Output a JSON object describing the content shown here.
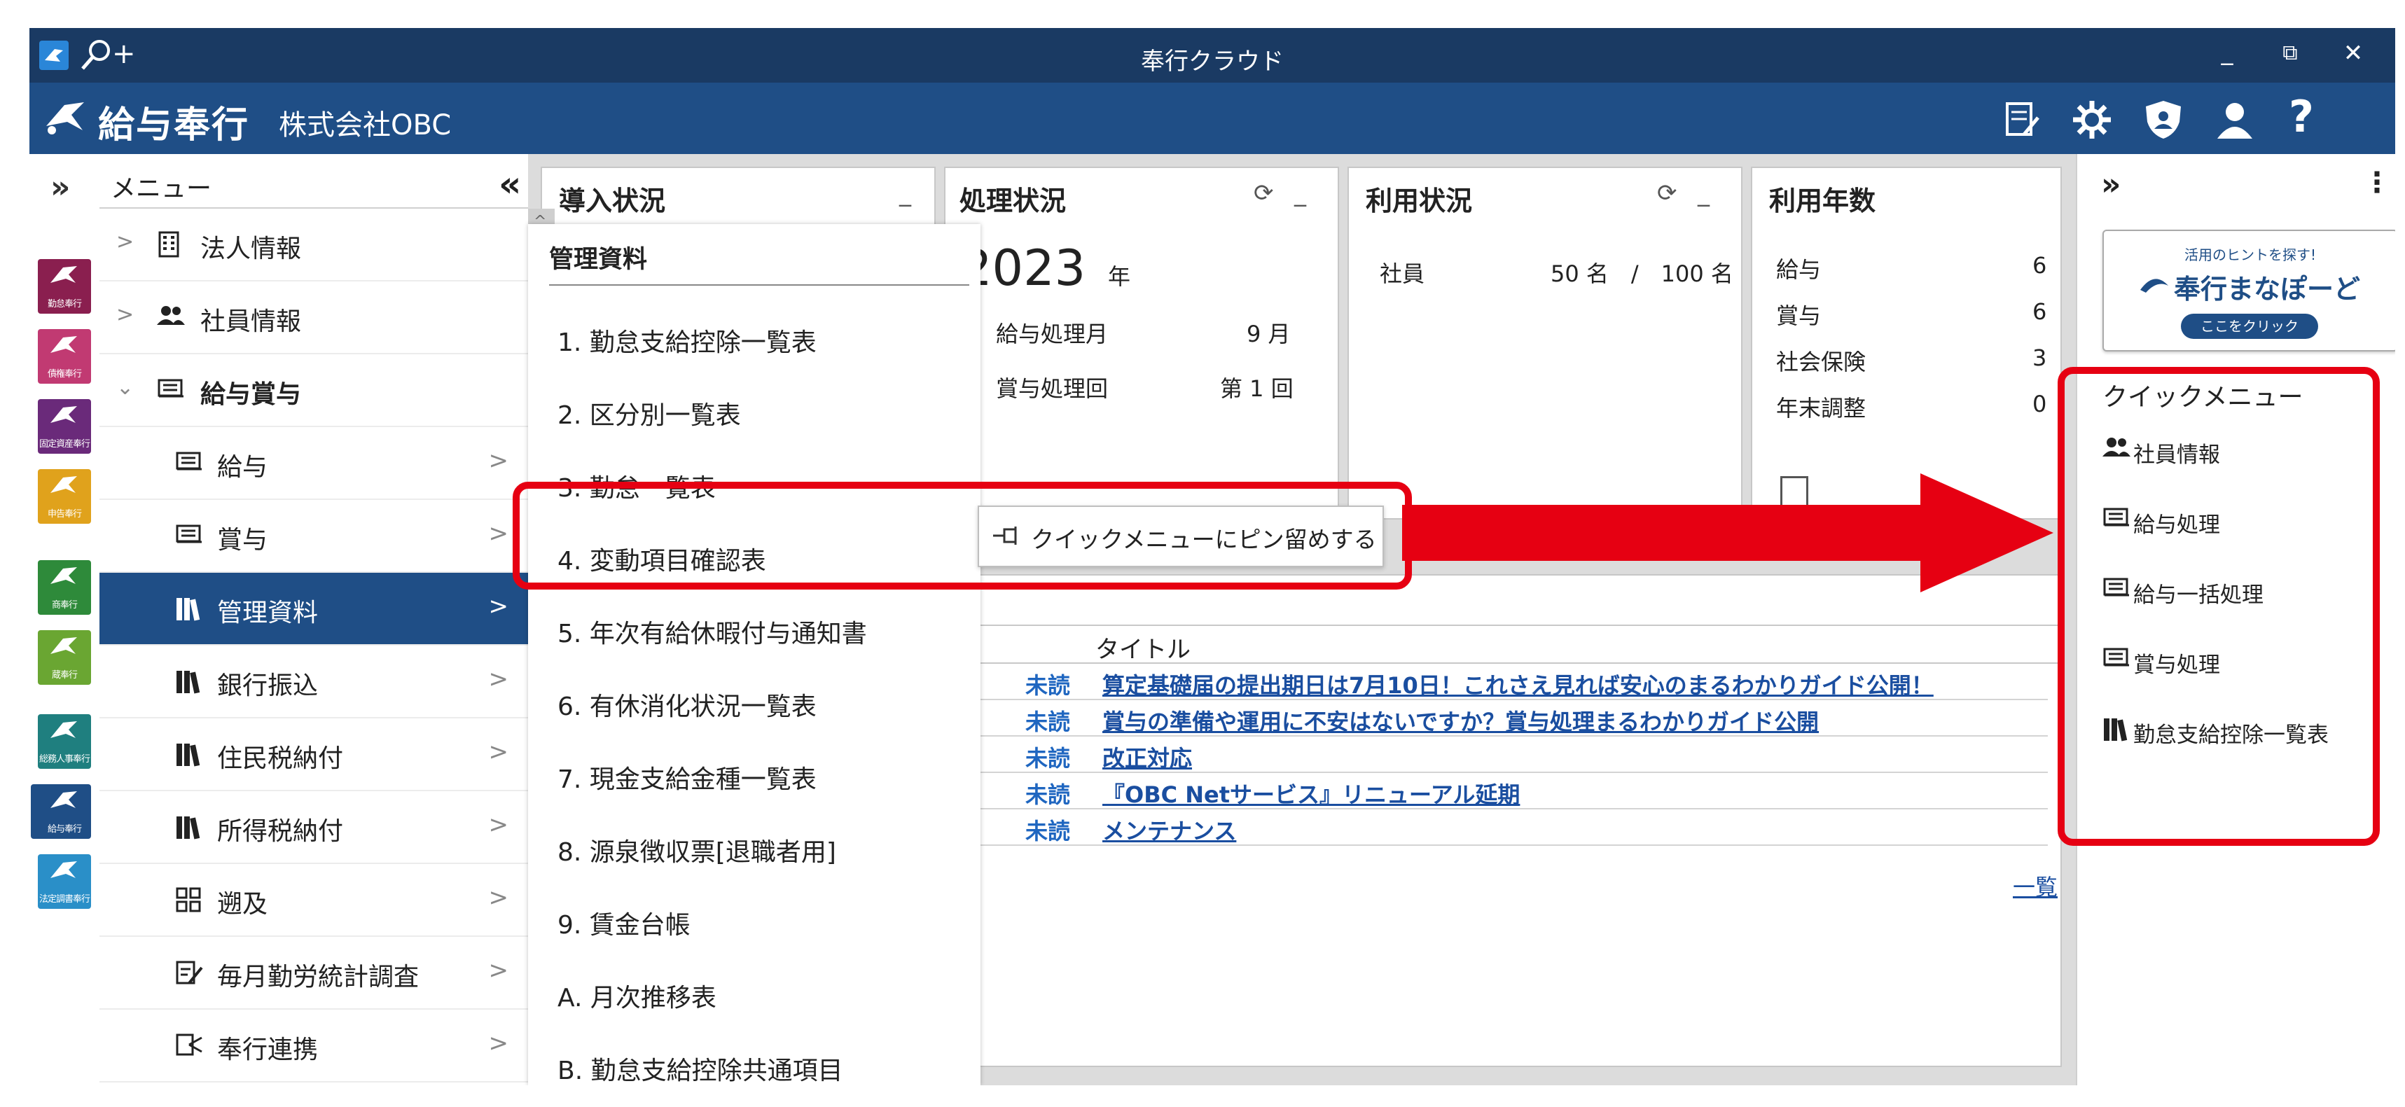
{
  "window": {
    "title": "奉行クラウド",
    "search_plus_label": "+",
    "minimize": "_",
    "maximize": "⧉",
    "close": "✕"
  },
  "appbar": {
    "product_name": "給与奉行",
    "company": "株式会社OBC"
  },
  "strip": {
    "expand": "»",
    "apps": [
      {
        "label": "勤怠奉行",
        "color": "#8a1f4f"
      },
      {
        "label": "債権奉行",
        "color": "#c13a72"
      },
      {
        "label": "固定資産奉行",
        "color": "#6a2a7a"
      },
      {
        "label": "申告奉行",
        "color": "#e0a21c"
      },
      {
        "label": "商奉行",
        "color": "#2e8a3a"
      },
      {
        "label": "蔵奉行",
        "color": "#6aa632"
      },
      {
        "label": "総務人事奉行",
        "color": "#1f7f7f"
      },
      {
        "label": "給与奉行",
        "color": "#1f4e86"
      },
      {
        "label": "法定調書奉行",
        "color": "#2a8fc8"
      }
    ]
  },
  "nav": {
    "header": "メニュー",
    "collapse": "«",
    "items": [
      {
        "label": "法人情報",
        "icon": "building-icon"
      },
      {
        "label": "社員情報",
        "icon": "people-icon"
      },
      {
        "label": "給与賞与",
        "icon": "payslip-icon"
      },
      {
        "label": "給与",
        "icon": "payslip-icon"
      },
      {
        "label": "賞与",
        "icon": "payslip-icon"
      },
      {
        "label": "管理資料",
        "icon": "books-icon"
      },
      {
        "label": "銀行振込",
        "icon": "books-icon"
      },
      {
        "label": "住民税納付",
        "icon": "books-icon"
      },
      {
        "label": "所得税納付",
        "icon": "books-icon"
      },
      {
        "label": "遡及",
        "icon": "grid-icon"
      },
      {
        "label": "毎月勤労統計調査",
        "icon": "edit-doc-icon"
      },
      {
        "label": "奉行連携",
        "icon": "link-icon"
      }
    ]
  },
  "dropdown": {
    "title": "管理資料",
    "items": [
      "1. 勤怠支給控除一覧表",
      "2. 区分別一覧表",
      "3. 勤怠一覧表",
      "4. 変動項目確認表",
      "5. 年次有給休暇付与通知書",
      "6. 有休消化状況一覧表",
      "7. 現金支給金種一覧表",
      "8. 源泉徴収票[退職者用]",
      "9. 賃金台帳",
      "A. 月次推移表",
      "B. 勤怠支給控除共通項目"
    ],
    "pin_tooltip": "クイックメニューにピン留めする"
  },
  "panels": {
    "intro": {
      "title": "導入状況",
      "minimize": "_"
    },
    "processing": {
      "title": "処理状況",
      "year": "2023",
      "year_unit": "年",
      "rows": [
        {
          "label": "給与処理月",
          "value": "9 月"
        },
        {
          "label": "賞与処理回",
          "value": "第 1 回"
        }
      ]
    },
    "usage": {
      "title": "利用状況",
      "employee_label": "社員",
      "employee_value": "50 名　/　100 名"
    },
    "years": {
      "title": "利用年数",
      "rows": [
        {
          "label": "給与",
          "value": "6"
        },
        {
          "label": "賞与",
          "value": "6"
        },
        {
          "label": "社会保険",
          "value": "3"
        },
        {
          "label": "年末調整",
          "value": "0"
        }
      ]
    }
  },
  "news": {
    "column_title": "タイトル",
    "rows": [
      {
        "status": "未読",
        "title": "算定基礎届の提出期日は7月10日！これさえ見れば安心のまるわかりガイド公開！"
      },
      {
        "status": "未読",
        "title": "賞与の準備や運用に不安はないですか？賞与処理まるわかりガイド公開"
      },
      {
        "status": "未読",
        "title": "改正対応"
      },
      {
        "status": "未読",
        "title": "『OBC Netサービス』リニューアル延期"
      },
      {
        "status": "未読",
        "title": "メンテナンス"
      }
    ],
    "more_link": "一覧"
  },
  "right_panel": {
    "expand": "»",
    "more": "⋮",
    "banner": {
      "top_text": "活用のヒントを探す!",
      "brand": "奉行まなぽーど",
      "button": "ここをクリック"
    },
    "quick_menu_title": "クイックメニュー",
    "quick_items": [
      {
        "label": "社員情報",
        "icon": "people-icon"
      },
      {
        "label": "給与処理",
        "icon": "payslip-icon"
      },
      {
        "label": "給与一括処理",
        "icon": "payslip-icon"
      },
      {
        "label": "賞与処理",
        "icon": "payslip-icon"
      },
      {
        "label": "勤怠支給控除一覧表",
        "icon": "books-icon"
      }
    ]
  },
  "colors": {
    "titlebar": "#1a3a63",
    "appbar": "#1f4e86",
    "highlight_red": "#e60012",
    "link_blue": "#1a4ea0"
  }
}
